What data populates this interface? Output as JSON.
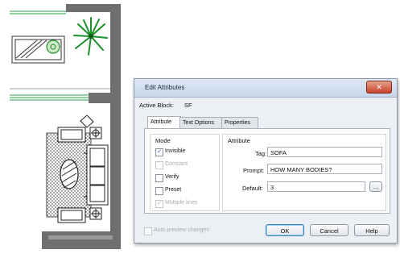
{
  "dialog": {
    "title": "Edit Attributes",
    "active_block_label": "Active Block:",
    "active_block_value": "SF",
    "tabs": [
      {
        "label": "Attribute",
        "active": true
      },
      {
        "label": "Text Options",
        "active": false
      },
      {
        "label": "Properties",
        "active": false
      }
    ],
    "mode": {
      "title": "Mode",
      "options": [
        {
          "label": "Invisible",
          "checked": true,
          "enabled": true
        },
        {
          "label": "Constant",
          "checked": false,
          "enabled": false
        },
        {
          "label": "Verify",
          "checked": false,
          "enabled": true
        },
        {
          "label": "Preset",
          "checked": false,
          "enabled": true
        },
        {
          "label": "Multiple lines",
          "checked": true,
          "enabled": false
        }
      ]
    },
    "attribute": {
      "title": "Attribute",
      "tag_label": "Tag:",
      "tag_value": "SOFA",
      "prompt_label": "Prompt:",
      "prompt_value": "HOW MANY BODIES?",
      "default_label": "Default:",
      "default_value": "3",
      "browse_label": "..."
    },
    "auto_preview_label": "Auto preview changes",
    "ok_label": "OK",
    "cancel_label": "Cancel",
    "help_label": "Help",
    "close_glyph": "✕"
  },
  "colors": {
    "wall": "#6f6f6f",
    "window_line": "#2aa84a",
    "plant": "#1a8f2a",
    "hatch": "#222222"
  },
  "icons": [
    "plant-icon",
    "close-icon",
    "checkbox-icon"
  ]
}
